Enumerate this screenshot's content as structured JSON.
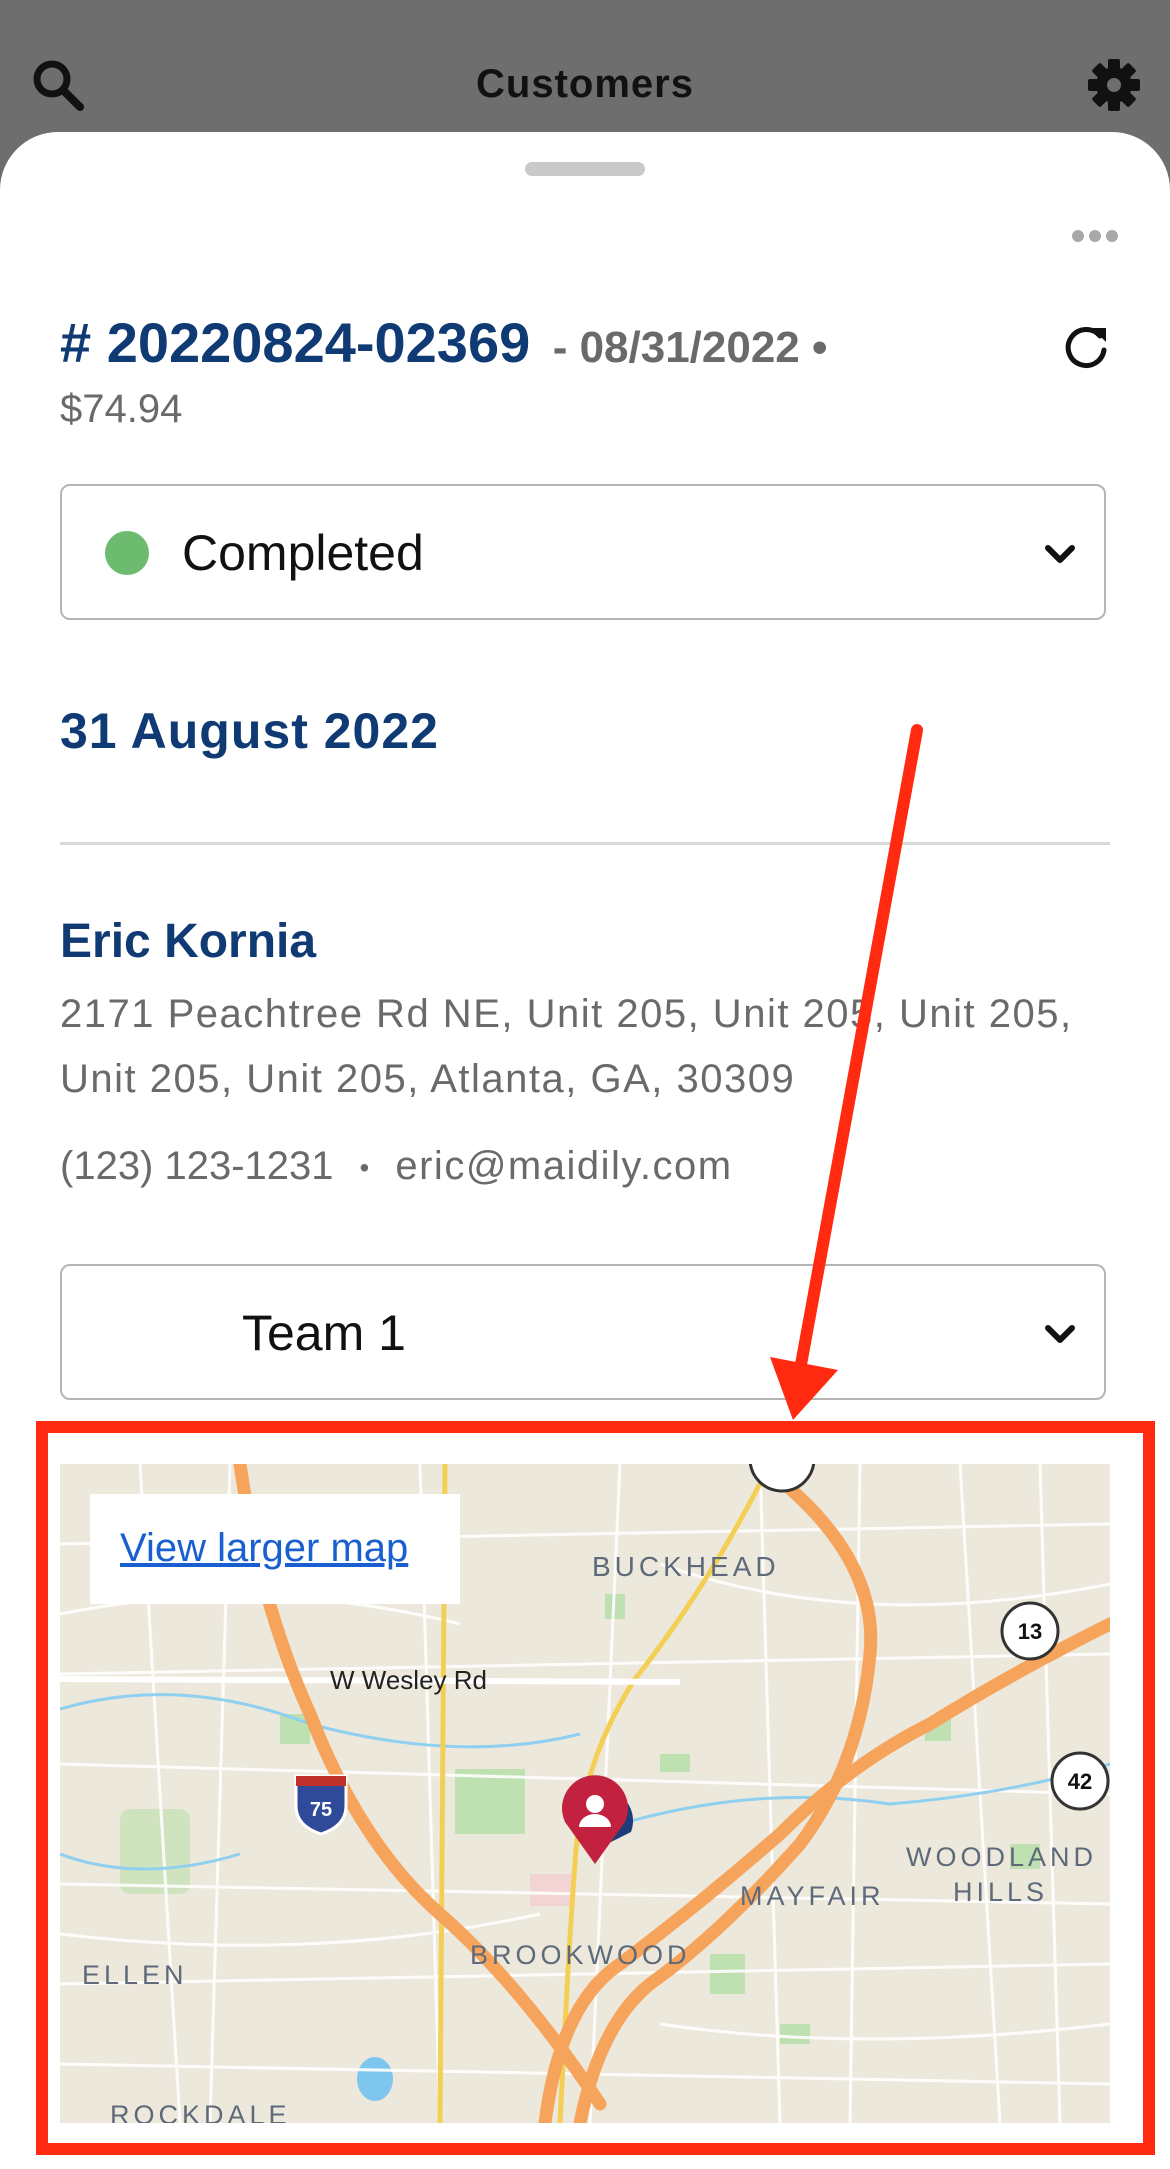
{
  "header": {
    "title": "Customers",
    "search_icon": "search-icon",
    "settings_icon": "gear-icon"
  },
  "order": {
    "number": "# 20220824-02369",
    "date": "- 08/31/2022 •",
    "price": "$74.94"
  },
  "status": {
    "label": "Completed",
    "color": "#6dbb6f"
  },
  "schedule": {
    "date_heading": "31 August 2022"
  },
  "customer": {
    "name": "Eric Kornia",
    "address": "2171 Peachtree Rd NE, Unit 205, Unit 205, Unit 205, Unit 205, Unit 205, Atlanta, GA, 30309",
    "phone": "(123) 123-1231",
    "separator": "•",
    "email": "eric@maidily.com"
  },
  "team": {
    "label": "Team 1"
  },
  "map": {
    "link_text": "View larger map",
    "labels": {
      "buckhead": "BUCKHEAD",
      "wesley": "W Wesley Rd",
      "woodland_1": "WOODLAND",
      "woodland_2": "HILLS",
      "mayfair": "MAYFAIR",
      "brookwood": "BROOKWOOD",
      "ellen": "ELLEN",
      "rockdale": "ROCKDALE"
    },
    "shields": {
      "i75": "75",
      "r13": "13",
      "r42": "42"
    }
  },
  "colors": {
    "brand_navy": "#0f3a73",
    "annotation_red": "#ff2a10",
    "highway_orange": "#f6a45c"
  }
}
